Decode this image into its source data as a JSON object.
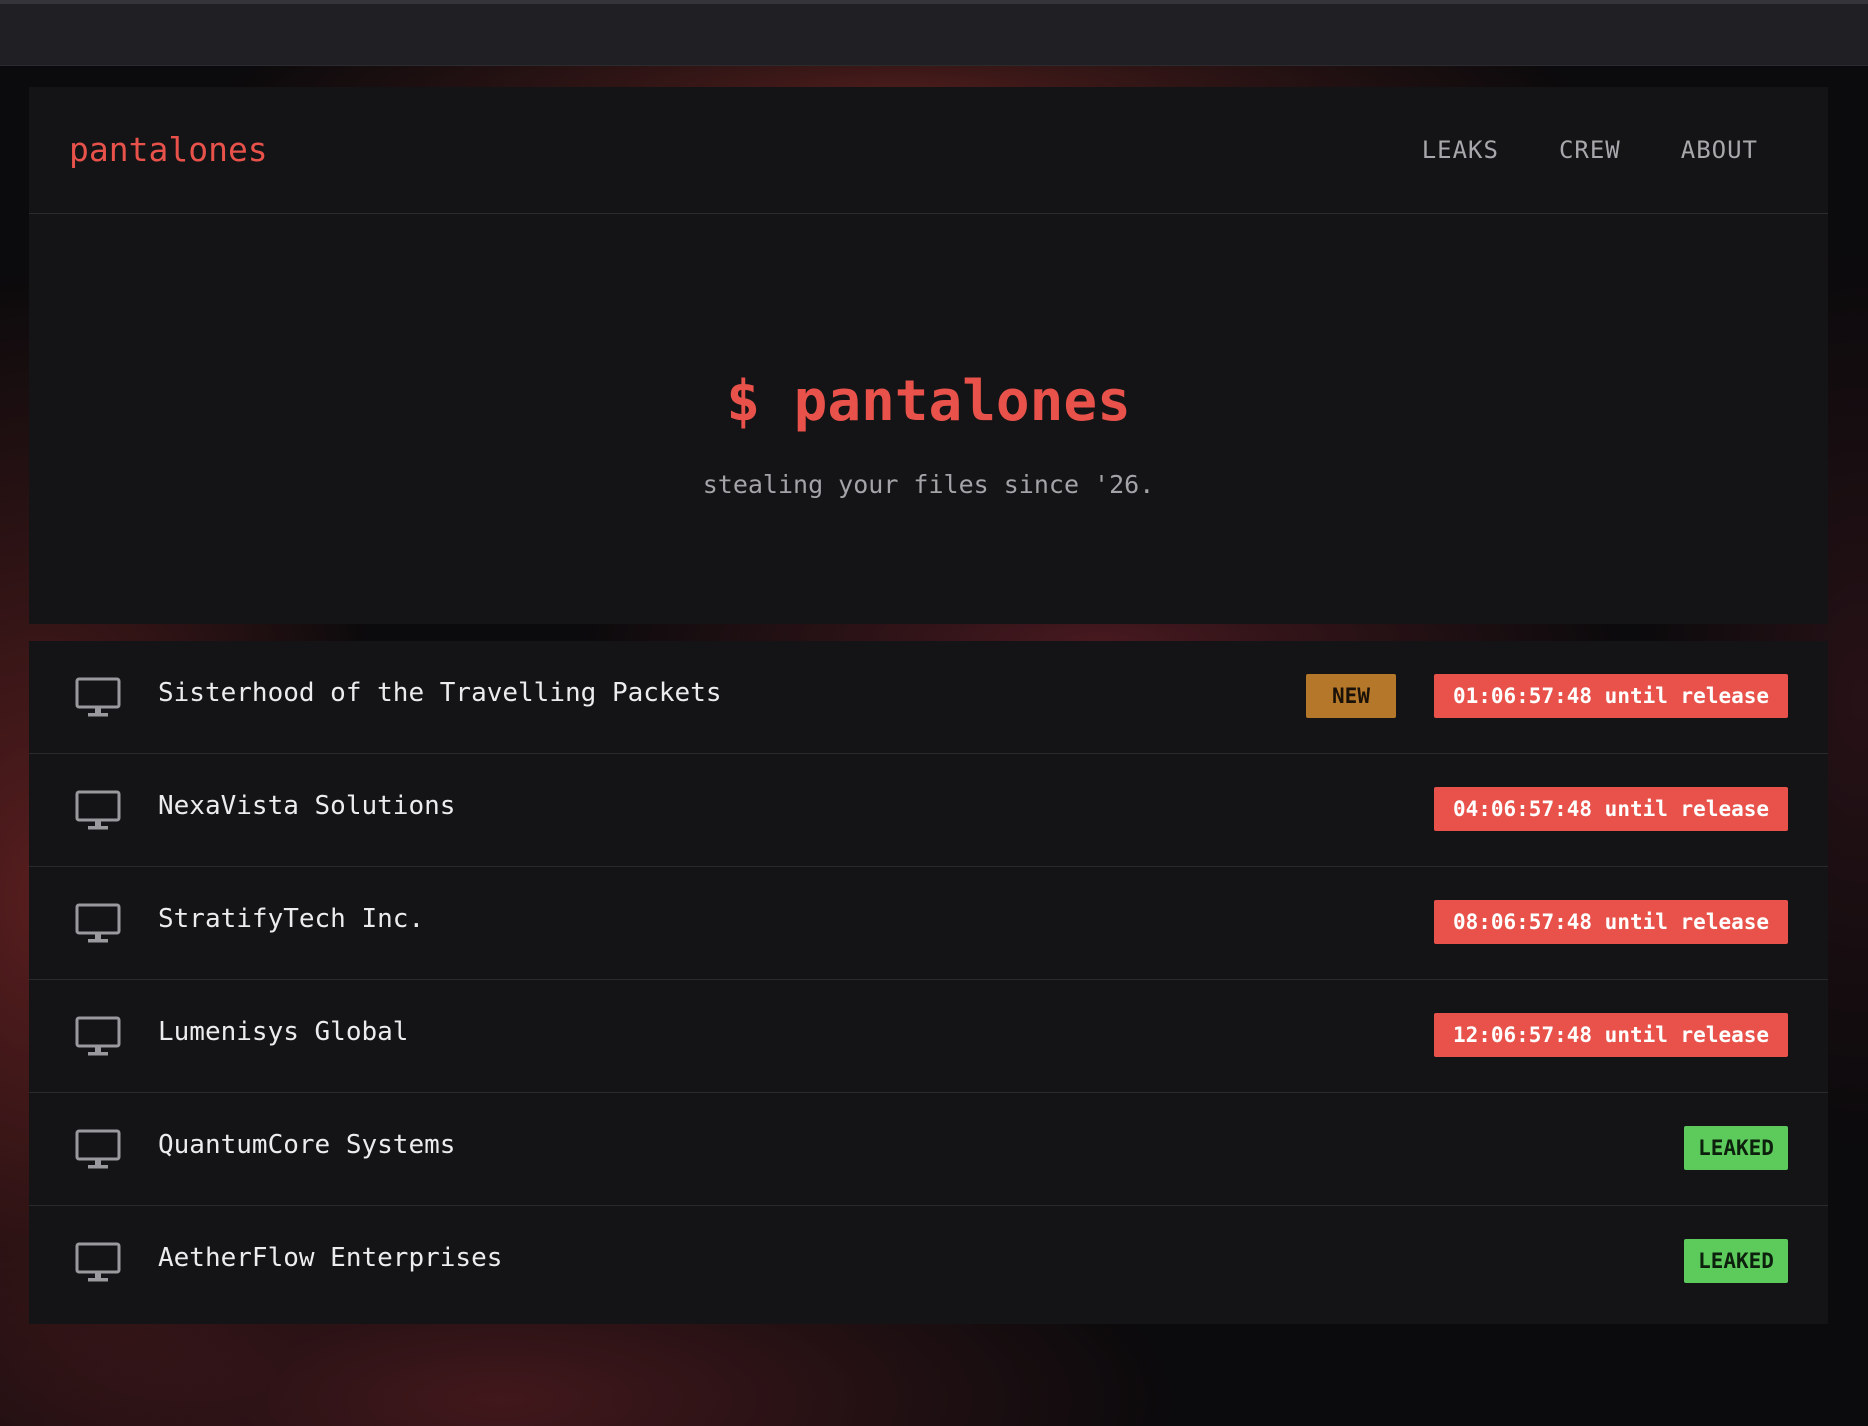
{
  "site": {
    "brand": "pantalones",
    "nav": [
      "LEAKS",
      "CREW",
      "ABOUT"
    ]
  },
  "hero": {
    "title": "$ pantalones",
    "subtitle": "stealing your files since '26."
  },
  "entries": [
    {
      "name": "Sisterhood of the Travelling Packets",
      "new_badge": "NEW",
      "status": "01:06:57:48 until release",
      "status_type": "countdown"
    },
    {
      "name": "NexaVista Solutions",
      "status": "04:06:57:48 until release",
      "status_type": "countdown"
    },
    {
      "name": "StratifyTech Inc.",
      "status": "08:06:57:48 until release",
      "status_type": "countdown"
    },
    {
      "name": "Lumenisys Global",
      "status": "12:06:57:48 until release",
      "status_type": "countdown"
    },
    {
      "name": "QuantumCore Systems",
      "status": "LEAKED",
      "status_type": "leaked"
    },
    {
      "name": "AetherFlow Enterprises",
      "status": "LEAKED",
      "status_type": "leaked"
    }
  ],
  "colors": {
    "accent": "#e8524a",
    "new_badge": "#b5782a",
    "leaked_badge": "#5ccb5c",
    "card_bg": "#141416"
  },
  "icons": {
    "row_icon": "monitor-icon"
  }
}
